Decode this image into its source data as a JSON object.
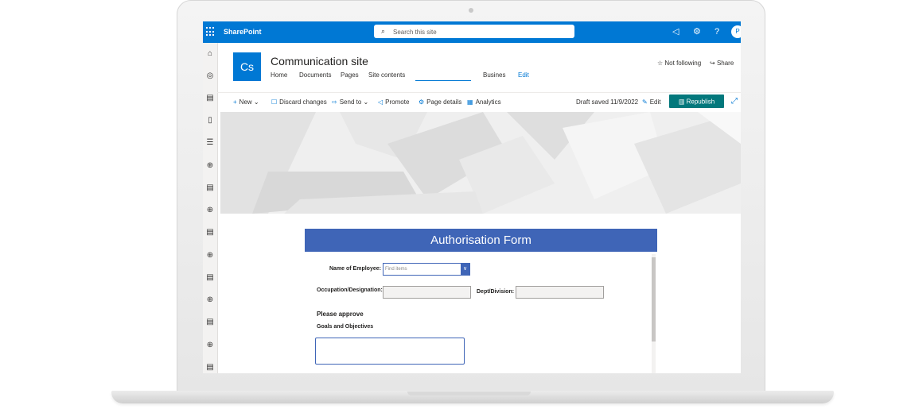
{
  "suite_bar": {
    "brand": "SharePoint",
    "search_placeholder": "Search this site",
    "avatar_initial": "P"
  },
  "site": {
    "logo_initials": "Cs",
    "title": "Communication site",
    "nav": [
      "Home",
      "Documents",
      "Pages",
      "Site contents",
      "Busines",
      "Edit"
    ],
    "follow_label": "Not following",
    "share_label": "Share"
  },
  "command_bar": {
    "new_label": "New",
    "discard_label": "Discard changes",
    "send_label": "Send to",
    "promote_label": "Promote",
    "page_details_label": "Page details",
    "analytics_label": "Analytics",
    "draft_status": "Draft saved 11/9/2022",
    "edit_label": "Edit",
    "republish_label": "Republish"
  },
  "form": {
    "header": "Authorisation Form",
    "name_label": "Name of Employee:",
    "name_placeholder": "Find items",
    "occupation_label": "Occupation/Designation:",
    "dept_label": "Dept/Division:",
    "approve_heading": "Please approve",
    "goals_label": "Goals and Objectives"
  },
  "colors": {
    "suite_bar": "#0078d4",
    "form_header": "#3f65b7",
    "republish": "#03787c"
  },
  "icons": {
    "rail": [
      "home-icon",
      "globe-icon",
      "news-icon",
      "document-icon",
      "list-icon",
      "add-circle-icon",
      "news-icon",
      "add-circle-icon",
      "news-icon",
      "add-circle-icon",
      "news-icon",
      "add-circle-icon",
      "news-icon",
      "add-circle-icon",
      "news-icon"
    ]
  }
}
